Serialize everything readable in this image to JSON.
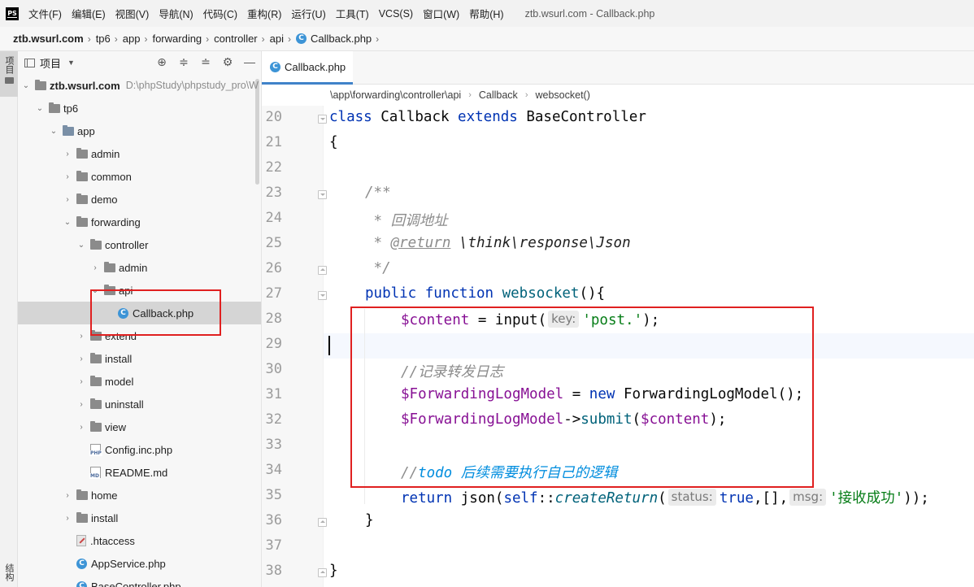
{
  "menubar": {
    "logo_text": "PS",
    "items": [
      "文件(F)",
      "编辑(E)",
      "视图(V)",
      "导航(N)",
      "代码(C)",
      "重构(R)",
      "运行(U)",
      "工具(T)",
      "VCS(S)",
      "窗口(W)",
      "帮助(H)"
    ],
    "window_title": "ztb.wsurl.com - Callback.php"
  },
  "navbar": {
    "crumbs": [
      "ztb.wsurl.com",
      "tp6",
      "app",
      "forwarding",
      "controller",
      "api",
      "Callback.php"
    ]
  },
  "tool_stripe": {
    "project_tab": "项目",
    "structure_tab": "结构"
  },
  "project_panel": {
    "title": "项目",
    "root_path": "D:\\phpStudy\\phpstudy_pro\\W",
    "tree": [
      {
        "label": "ztb.wsurl.com"
      },
      {
        "label": "tp6"
      },
      {
        "label": "app"
      },
      {
        "label": "admin"
      },
      {
        "label": "common"
      },
      {
        "label": "demo"
      },
      {
        "label": "forwarding"
      },
      {
        "label": "controller"
      },
      {
        "label": "admin"
      },
      {
        "label": "api"
      },
      {
        "label": "Callback.php"
      },
      {
        "label": "extend"
      },
      {
        "label": "install"
      },
      {
        "label": "model"
      },
      {
        "label": "uninstall"
      },
      {
        "label": "view"
      },
      {
        "label": "Config.inc.php"
      },
      {
        "label": "README.md"
      },
      {
        "label": "home"
      },
      {
        "label": "install"
      },
      {
        "label": ".htaccess"
      },
      {
        "label": "AppService.php"
      },
      {
        "label": "BaseController.php"
      }
    ]
  },
  "editor": {
    "tab_label": "Callback.php",
    "breadcrumbs": [
      "\\app\\forwarding\\controller\\api",
      "Callback",
      "websocket()"
    ],
    "line_numbers": [
      "20",
      "21",
      "22",
      "23",
      "24",
      "25",
      "26",
      "27",
      "28",
      "29",
      "30",
      "31",
      "32",
      "33",
      "34",
      "35",
      "36",
      "37",
      "38"
    ],
    "code": {
      "l20": {
        "kw1": "class",
        "name": " Callback ",
        "kw2": "extends",
        "base": " BaseController"
      },
      "l21": "{",
      "l23": "/**",
      "l24": " * 回调地址",
      "l25": {
        "star": " * ",
        "tag": "@return",
        "type": " \\think\\response\\Json"
      },
      "l26": " */",
      "l27": {
        "kw1": "public",
        "kw2": "function",
        "fn": "websocket",
        "rest": "(){"
      },
      "l28": {
        "var": "$content",
        "mid": " = input(",
        "hint": "key:",
        "str": "'post.'",
        "end": ");"
      },
      "l30": "//记录转发日志",
      "l31": {
        "var": "$ForwardingLogModel",
        "mid": " = ",
        "kw": "new",
        "rest": " ForwardingLogModel();"
      },
      "l32": {
        "var": "$ForwardingLogModel",
        "arrow": "->",
        "fn": "submit",
        "open": "(",
        "arg": "$content",
        "end": ");"
      },
      "l34": {
        "slashes": "//",
        "todo": "todo",
        "text": " 后续需要执行自己的逻辑"
      },
      "l35": {
        "kw": "return",
        "mid": " json(",
        "self": "self",
        "dc": "::",
        "fn": "createReturn",
        "open": "(",
        "hint1": "status:",
        "true": "true",
        "arr": ",[],",
        "hint2": "msg:",
        "str": "'接收成功'",
        "end": "));"
      },
      "l36": "}",
      "l38": "}"
    }
  },
  "colors": {
    "annotation_red": "#e02020",
    "php_icon_blue": "#3d94d6",
    "keyword": "#0033b3",
    "string": "#067d17",
    "variable": "#871094",
    "comment": "#8c8c8c"
  }
}
